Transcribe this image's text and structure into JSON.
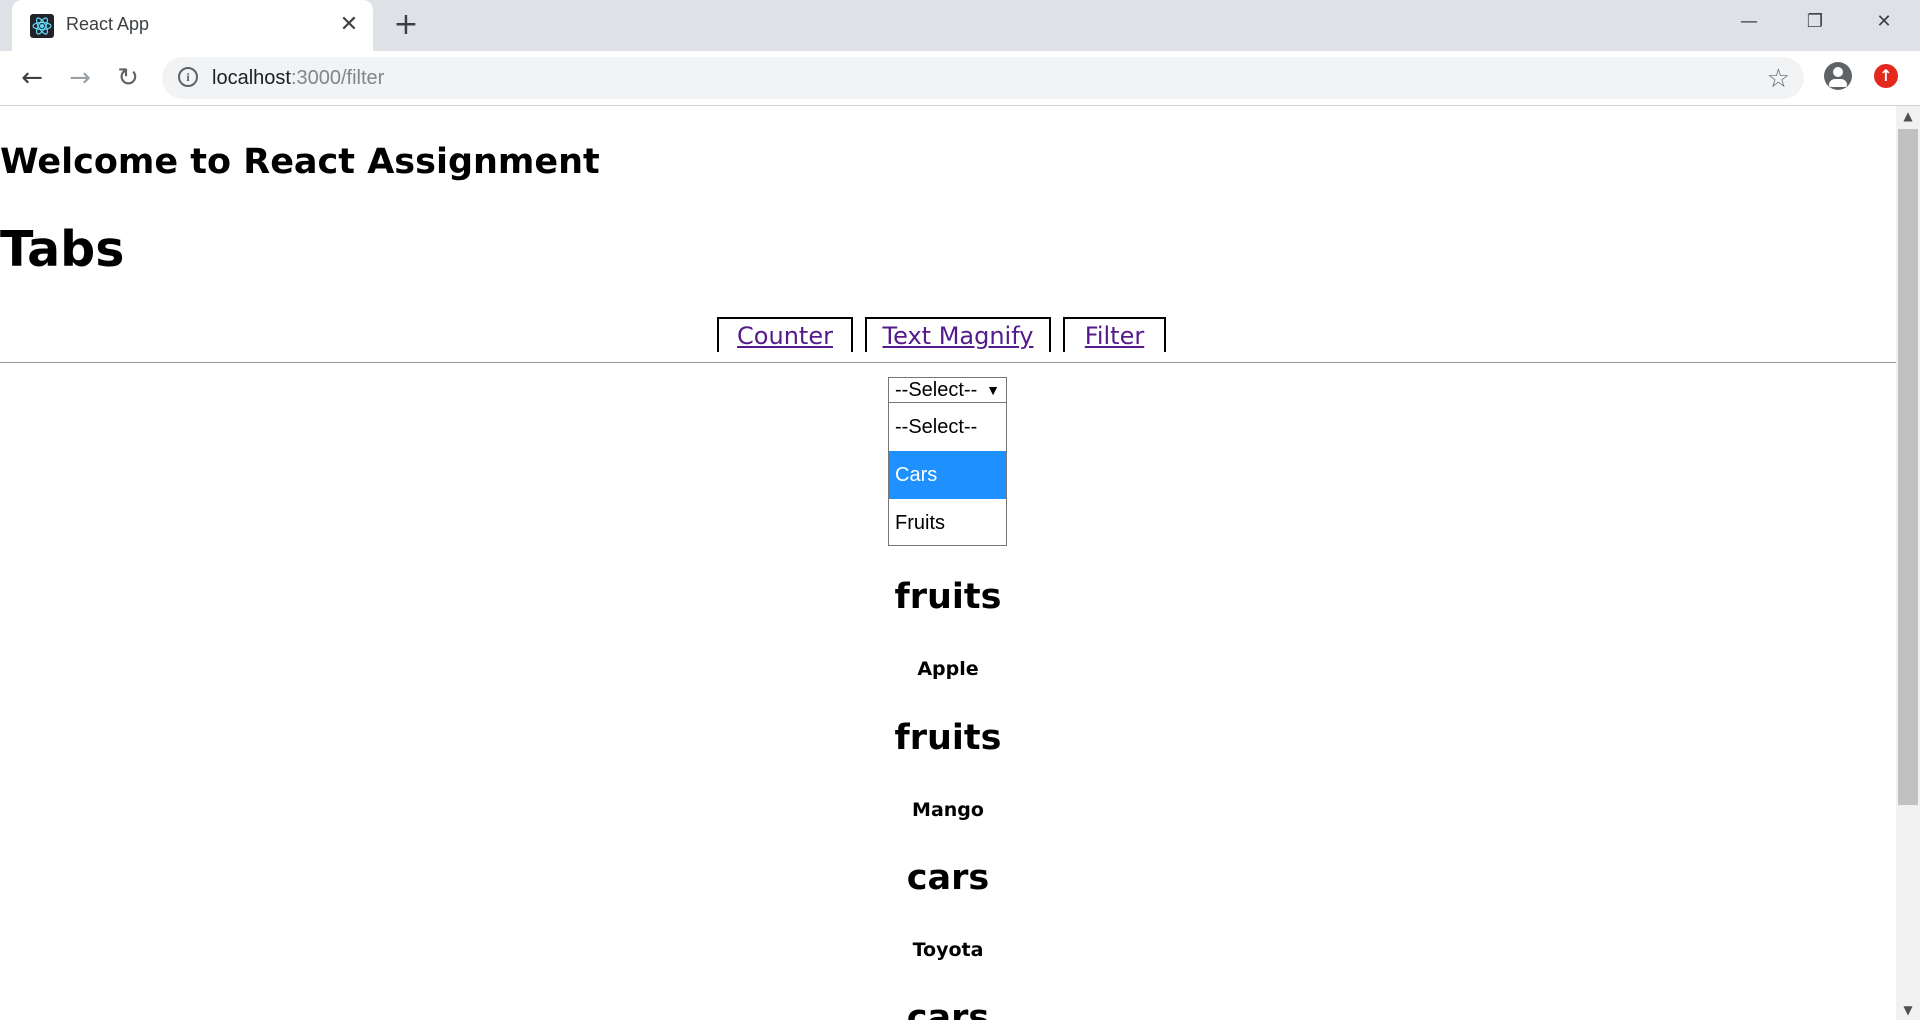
{
  "browser": {
    "tab_title": "React App",
    "new_tab_symbol": "+",
    "close_symbol": "✕",
    "url_host": "localhost",
    "url_path": ":3000/filter",
    "window_controls": {
      "minimize": "—",
      "restore": "❐",
      "close": "✕"
    }
  },
  "page": {
    "welcome": "Welcome to React Assignment",
    "tabs_heading": "Tabs",
    "tabs": [
      {
        "label": "Counter"
      },
      {
        "label": "Text Magnify"
      },
      {
        "label": "Filter"
      }
    ],
    "select": {
      "selected": "--Select--",
      "options": [
        "--Select--",
        "Cars",
        "Fruits"
      ],
      "highlighted": "Cars"
    },
    "results": [
      {
        "category": "fruits",
        "item": "Apple"
      },
      {
        "category": "fruits",
        "item": "Mango"
      },
      {
        "category": "cars",
        "item": "Toyota"
      },
      {
        "category": "cars",
        "item": ""
      }
    ]
  },
  "colors": {
    "link": "#551a8b",
    "highlight": "#1e90ff",
    "update_badge": "#e3281d"
  }
}
